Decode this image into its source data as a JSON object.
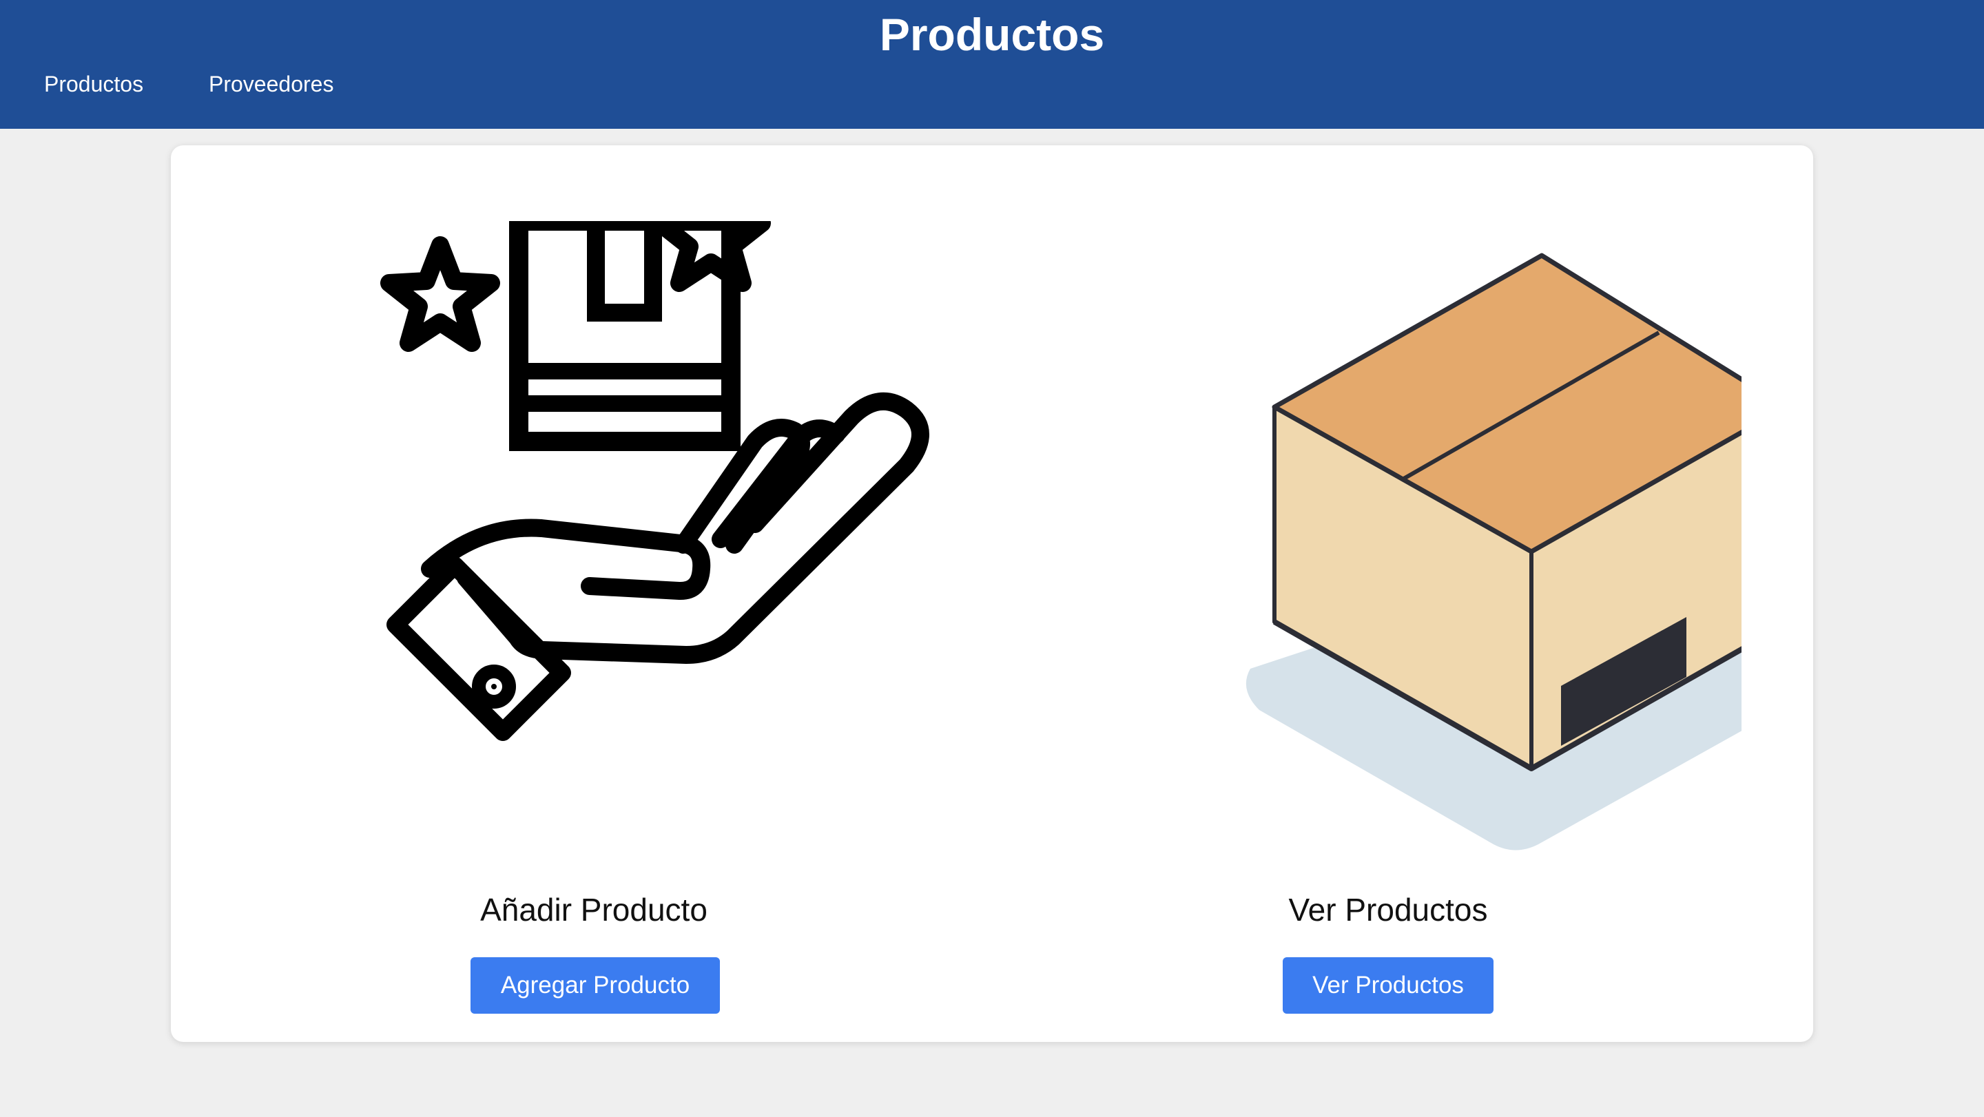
{
  "header": {
    "title": "Productos",
    "nav": [
      {
        "label": "Productos"
      },
      {
        "label": "Proveedores"
      }
    ]
  },
  "cards": {
    "add": {
      "title": "Añadir Producto",
      "button_label": "Agregar Producto",
      "icon": "hand-with-box-icon"
    },
    "view": {
      "title": "Ver Productos",
      "button_label": "Ver Productos",
      "icon": "cardboard-box-icon"
    }
  },
  "colors": {
    "header_bg": "#1f4e96",
    "button_bg": "#3b7cf0",
    "page_bg": "#efefef",
    "box_top": "#e4a96c",
    "box_side": "#f0d8ae",
    "box_shadow": "#d6e2ea",
    "box_label": "#2c2d35"
  }
}
